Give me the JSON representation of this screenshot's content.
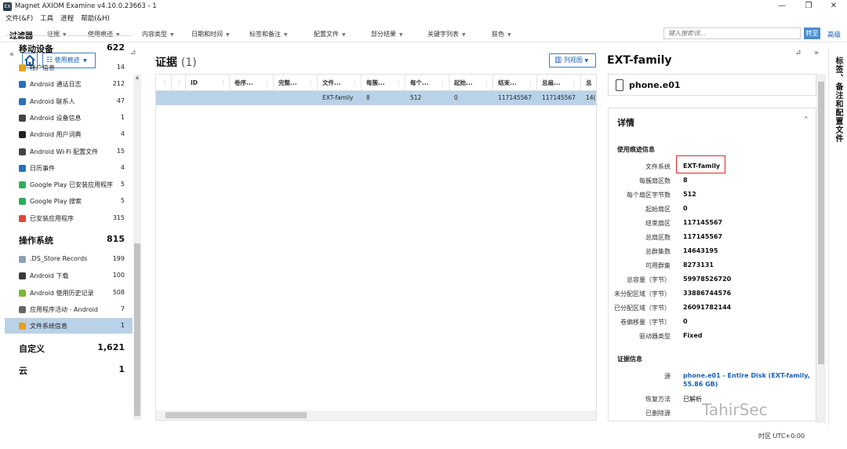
{
  "window": {
    "title": "Magnet AXIOM Examine v4.10.0.23663 - 1",
    "app_icon_text": "EX",
    "minimize": "—",
    "maximize": "❐",
    "close": "✕"
  },
  "menu": [
    "文件(&F)",
    "工具",
    "进程",
    "帮助(&H)"
  ],
  "filterbar": {
    "label": "过滤器",
    "dropdowns": [
      "证据",
      "使用痕迹",
      "内容类型",
      "日期和时间",
      "标签和备注",
      "配置文件",
      "部分结果",
      "关键字列表",
      "肤色"
    ],
    "search_placeholder": "键入搜索词...",
    "go_label": "转至",
    "advanced_label": "高级"
  },
  "left_panel": {
    "collapse_glyph": "«",
    "view_label": "使用痕迹",
    "categories": [
      {
        "title": "移动设备",
        "count": "622",
        "items": [
          {
            "label": "帐户信息",
            "count": "14",
            "color": "#e0a51a"
          },
          {
            "label": "Android 通话日志",
            "count": "212",
            "color": "#2a6fb8"
          },
          {
            "label": "Android 联系人",
            "count": "47",
            "color": "#2a6fb8"
          },
          {
            "label": "Android 设备信息",
            "count": "1",
            "color": "#444444"
          },
          {
            "label": "Android 用户词典",
            "count": "4",
            "color": "#222222"
          },
          {
            "label": "Android Wi-Fi 配置文件",
            "count": "15",
            "color": "#444444"
          },
          {
            "label": "日历事件",
            "count": "4",
            "color": "#2a6fb8"
          },
          {
            "label": "Google Play 已安装应用程序",
            "count": "5",
            "color": "#2fae5c"
          },
          {
            "label": "Google Play 搜索",
            "count": "5",
            "color": "#2fae5c"
          },
          {
            "label": "已安装应用程序",
            "count": "315",
            "color": "#d84a3a"
          }
        ]
      },
      {
        "title": "操作系统",
        "count": "815",
        "items": [
          {
            "label": ".DS_Store Records",
            "count": "199",
            "color": "#8aa0b6"
          },
          {
            "label": "Android 下载",
            "count": "100",
            "color": "#3a3a3a"
          },
          {
            "label": "Android 使用历史记录",
            "count": "508",
            "color": "#79b832"
          },
          {
            "label": "应用程序活动 - Android",
            "count": "7",
            "color": "#666666"
          },
          {
            "label": "文件系统信息",
            "count": "1",
            "color": "#e8a020"
          }
        ]
      },
      {
        "title": "自定义",
        "count": "1,621",
        "items": []
      },
      {
        "title": "云",
        "count": "1",
        "items": []
      }
    ]
  },
  "evidence": {
    "title": "证据",
    "count": "(1)",
    "columns_label": "列视图",
    "columns": [
      "ID",
      "卷序...",
      "完整...",
      "文件...",
      "每簇...",
      "每个...",
      "起始...",
      "结束...",
      "总扇...",
      "总"
    ],
    "row": [
      "",
      "",
      "",
      "EXT-family",
      "8",
      "512",
      "0",
      "117145567",
      "117145567",
      "14("
    ]
  },
  "detail": {
    "title": "EXT-family",
    "source_name": "phone.e01",
    "details_heading": "详情",
    "section_usage": "使用痕迹信息",
    "fields": [
      {
        "label": "文件系统",
        "value": "EXT-family"
      },
      {
        "label": "每簇扇区数",
        "value": "8"
      },
      {
        "label": "每个扇区字节数",
        "value": "512"
      },
      {
        "label": "起始扇区",
        "value": "0"
      },
      {
        "label": "结束扇区",
        "value": "117145567"
      },
      {
        "label": "总扇区数",
        "value": "117145567"
      },
      {
        "label": "总群集数",
        "value": "14643195"
      },
      {
        "label": "可用群集",
        "value": "8273131"
      },
      {
        "label": "总容量（字节）",
        "value": "59978526720"
      },
      {
        "label": "未分配区域（字节）",
        "value": "33886744576"
      },
      {
        "label": "已分配区域（字节）",
        "value": "26091782144"
      },
      {
        "label": "卷偏移量（字节）",
        "value": "0"
      },
      {
        "label": "驱动器类型",
        "value": "Fixed"
      }
    ],
    "section_evidence": "证据信息",
    "evidence_fields": [
      {
        "label": "源",
        "value": "phone.e01 - Entire Disk (EXT-family,",
        "value2": "55.86 GB)"
      },
      {
        "label": "恢复方法",
        "value": "已解析"
      },
      {
        "label": "已删除源",
        "value": ""
      }
    ]
  },
  "side_tab": "标签、备注和配置文件",
  "statusbar": {
    "timezone": "时区  UTC+0:00"
  },
  "watermark": "TahirSec"
}
